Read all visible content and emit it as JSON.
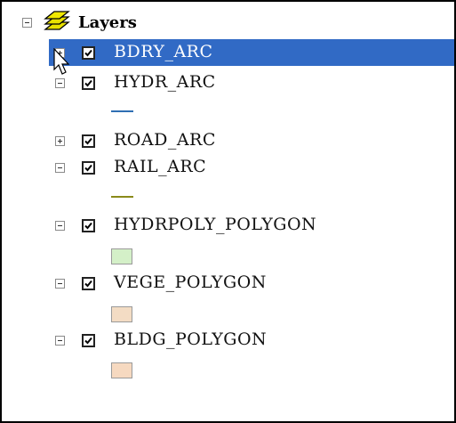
{
  "tree": {
    "root_label": "Layers",
    "layers": [
      {
        "name": "BDRY_ARC",
        "checked": true,
        "expanded": false,
        "selected": true
      },
      {
        "name": "HYDR_ARC",
        "checked": true,
        "expanded": true,
        "symbol": {
          "type": "line",
          "color": "#2f6fb3"
        }
      },
      {
        "name": "ROAD_ARC",
        "checked": true,
        "expanded": false
      },
      {
        "name": "RAIL_ARC",
        "checked": true,
        "expanded": true,
        "symbol": {
          "type": "line",
          "color": "#8a8a1a"
        }
      },
      {
        "name": "HYDRPOLY_POLYGON",
        "checked": true,
        "expanded": true,
        "symbol": {
          "type": "fill",
          "color": "#d4f0c8"
        }
      },
      {
        "name": "VEGE_POLYGON",
        "checked": true,
        "expanded": true,
        "symbol": {
          "type": "fill",
          "color": "#f3dcc4"
        }
      },
      {
        "name": "BLDG_POLYGON",
        "checked": true,
        "expanded": true,
        "symbol": {
          "type": "fill",
          "color": "#f6d9c0"
        }
      }
    ]
  },
  "colors": {
    "selection": "#316ac5",
    "border": "#000000"
  }
}
